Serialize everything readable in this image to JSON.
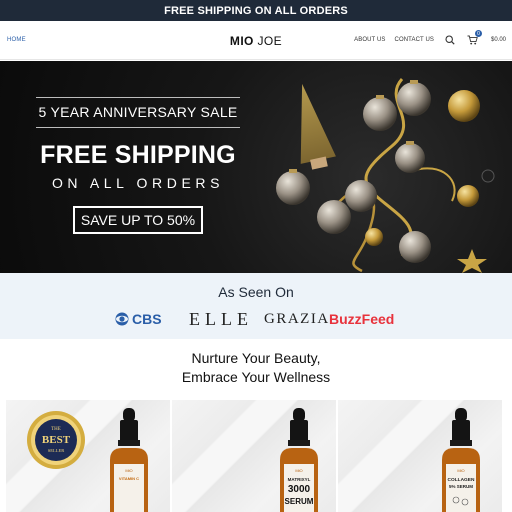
{
  "announcement": "FREE SHIPPING ON ALL ORDERS",
  "header": {
    "nav_home": "HOME",
    "logo_strong": "MIO",
    "logo_light": "JOE",
    "nav_about": "ABOUT US",
    "nav_contact": "CONTACT US",
    "cart_count": "0",
    "cart_total": "$0.00"
  },
  "hero": {
    "subtitle": "5 YEAR ANNIVERSARY SALE",
    "title": "FREE SHIPPING",
    "subtitle2": "ON ALL ORDERS",
    "cta": "SAVE UP TO 50%"
  },
  "seen": {
    "title": "As Seen On",
    "brands": [
      "CBS",
      "ELLE",
      "GRAZIA",
      "BuzzFeed"
    ]
  },
  "tagline": {
    "line1": "Nurture Your Beauty,",
    "line2": "Embrace Your Wellness"
  },
  "products": [
    {
      "badge_top": "THE",
      "badge_main": "BEST",
      "badge_bottom": "SELLER",
      "label_top": "MiO",
      "label_main": "VITAMIN C"
    },
    {
      "label_top": "MiO",
      "label_main": "MATRIXYL",
      "label_num": "3000",
      "label_sub": "SERUM"
    },
    {
      "label_top": "MiO",
      "label_main": "COLLAGEN",
      "label_sub": "5% SERUM"
    }
  ],
  "colors": {
    "topbar": "#1f2a39",
    "accent": "#2a5ea8",
    "seen_bg": "#edf3f9",
    "buzzfeed": "#e8323c",
    "gold": "#c9a545"
  },
  "icons": [
    "search-icon",
    "cart-icon"
  ]
}
